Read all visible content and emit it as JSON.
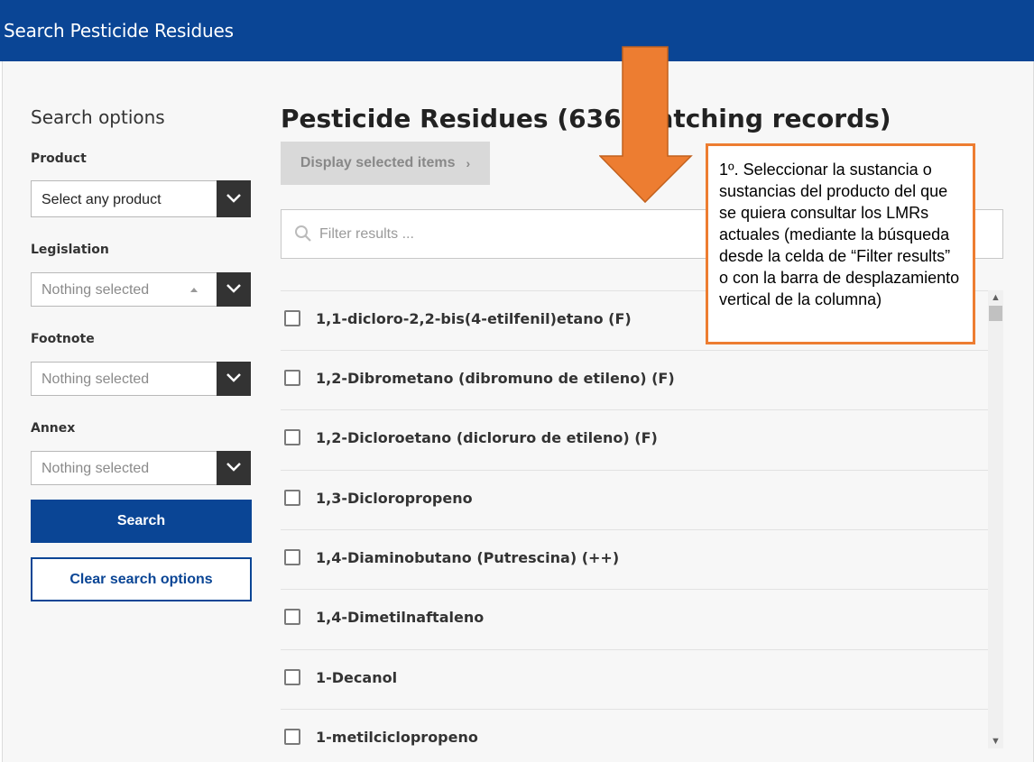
{
  "header": {
    "title": "Search Pesticide Residues"
  },
  "sidebar": {
    "title": "Search options",
    "product": {
      "label": "Product",
      "value": "Select any product"
    },
    "legislation": {
      "label": "Legislation",
      "placeholder": "Nothing selected"
    },
    "footnote": {
      "label": "Footnote",
      "placeholder": "Nothing selected"
    },
    "annex": {
      "label": "Annex",
      "placeholder": "Nothing selected"
    },
    "search_label": "Search",
    "clear_label": "Clear search options"
  },
  "main": {
    "title": "Pesticide Residues (636 matching records)",
    "display_label": "Display selected items",
    "filter_placeholder": "Filter results ...",
    "items": [
      "1,1-dicloro-2,2-bis(4-etilfenil)etano (F)",
      "1,2-Dibrometano (dibromuno de etileno) (F)",
      "1,2-Dicloroetano (dicloruro de etileno) (F)",
      "1,3-Dicloropropeno",
      "1,4-Diaminobutano (Putrescina) (++)",
      "1,4-Dimetilnaftaleno",
      "1-Decanol",
      "1-metilciclopropeno"
    ]
  },
  "annotation": {
    "text": "1º. Seleccionar la sustancia o sustancias del producto del que se quiera consultar los LMRs actuales (mediante la búsqueda desde la celda de “Filter results” o con la barra de desplazamiento vertical de la columna)",
    "color": "#ed7d31"
  },
  "colors": {
    "brand": "#0a4595",
    "dark_button": "#333333"
  }
}
